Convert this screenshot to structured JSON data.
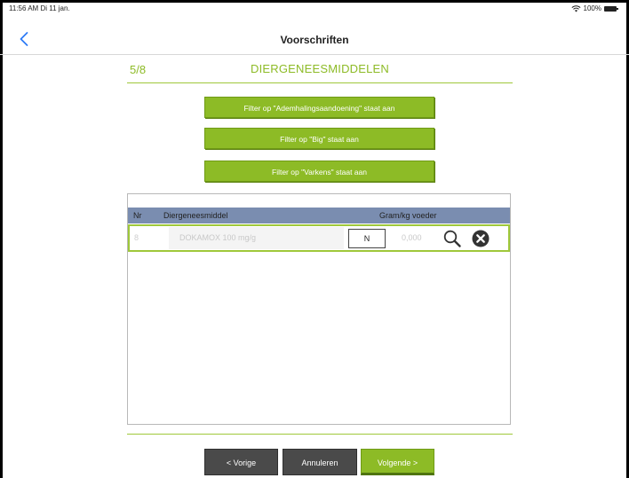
{
  "status_bar": {
    "time": "11:56 AM",
    "date": "Di 11 jan.",
    "battery": "100%",
    "wifi_icon": "wifi-icon",
    "battery_icon": "battery-icon"
  },
  "nav": {
    "title": "Voorschriften",
    "back_icon": "chevron-left-icon"
  },
  "step": {
    "counter": "5/8",
    "title": "DIERGENEESMIDDELEN"
  },
  "filters": [
    {
      "label": "Filter op \"Ademhalingsaandoening\" staat aan"
    },
    {
      "label": "Filter op \"Big\" staat aan"
    },
    {
      "label": "Filter op \"Varkens\" staat aan"
    }
  ],
  "table": {
    "columns": {
      "nr": "Nr",
      "name": "Diergeneesmiddel",
      "gram": "Gram/kg voeder"
    },
    "rows": [
      {
        "nr": "8",
        "name": "DOKAMOX 100 mg/g",
        "n_value": "N",
        "gram": "0,000"
      }
    ]
  },
  "footer": {
    "prev_label": "< Vorige",
    "cancel_label": "Annuleren",
    "next_label": "Volgende >"
  },
  "colors": {
    "accent_green": "#8dbb26",
    "header_blue": "#7a8db0",
    "dark_button": "#4a4a4a",
    "ios_blue": "#2f7cf6"
  }
}
